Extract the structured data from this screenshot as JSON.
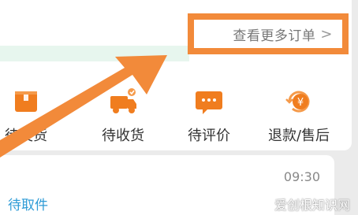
{
  "orders": {
    "more_label": "查看更多订单",
    "more_chevron": ">"
  },
  "actions": [
    {
      "label": "待发货",
      "icon": "box-icon"
    },
    {
      "label": "待收货",
      "icon": "truck-icon"
    },
    {
      "label": "待评价",
      "icon": "comment-icon"
    },
    {
      "label": "退款/售后",
      "icon": "refund-icon"
    }
  ],
  "pending": {
    "time": "09:30",
    "status": "待取件"
  },
  "watermark": "爱创根知识网",
  "colors": {
    "accent": "#f28a3a",
    "link": "#2e9bd6",
    "icon_orange": "#f07d1f"
  }
}
